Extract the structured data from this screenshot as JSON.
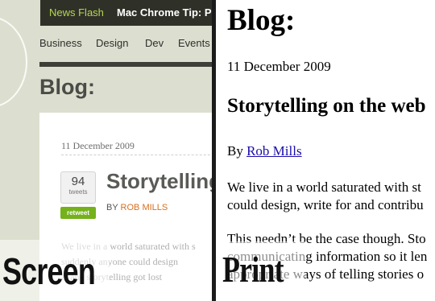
{
  "screen": {
    "news_label": "News Flash",
    "news_text": "Mac Chrome Tip: Pre",
    "nav": [
      "Business",
      "Design",
      "Dev",
      "Events"
    ],
    "title": "Blog:",
    "date": "11 December 2009",
    "tweet_count": "94",
    "tweet_label": "tweets",
    "retweet_label": "retweet",
    "headline": "Storytelling",
    "byline_prefix": "BY",
    "byline_author": "ROB MILLS",
    "body_lines": [
      "We live in a world saturated with s",
      "suddenly anyone could design",
      "a, and storytelling got lost"
    ],
    "label": "Screen"
  },
  "print": {
    "title": "Blog:",
    "date": "11 December 2009",
    "headline": "Storytelling on the web",
    "byline_prefix": "By",
    "byline_author": "Rob Mills",
    "paragraph1_lines": [
      "We live in a world saturated with st",
      "could design, write for and contribu"
    ],
    "paragraph2_lines": [
      "This needn’t be the case though. Sto",
      "communicating information so it len",
      "appropriate ways of telling stories o"
    ],
    "label": "Print"
  },
  "colors": {
    "screen_bg": "#dcdfcf",
    "news_accent": "#b6d652",
    "author_accent": "#d86f1c",
    "retweet_green": "#74b11b",
    "link_blue": "#1a0dab"
  }
}
